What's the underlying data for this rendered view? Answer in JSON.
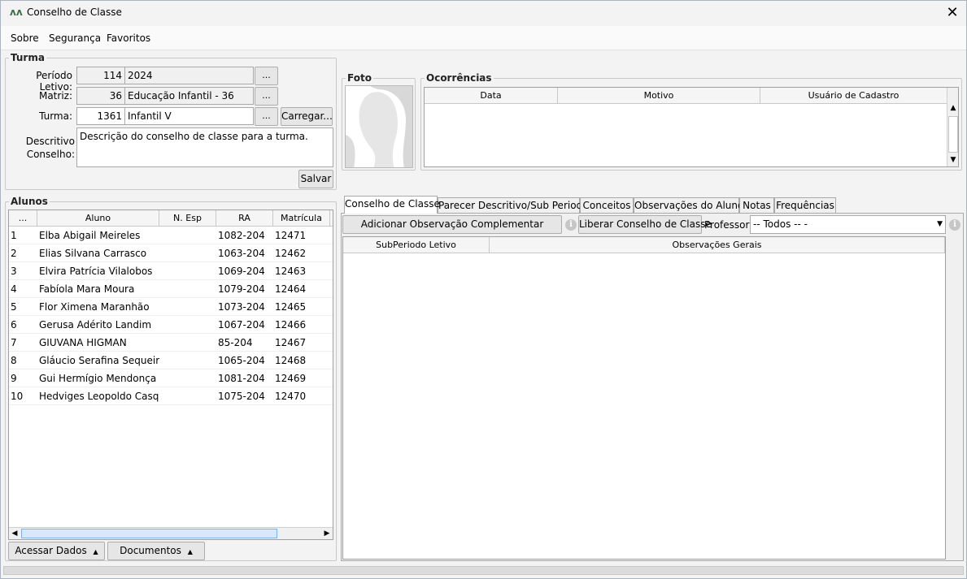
{
  "window": {
    "title": "Conselho de Classe",
    "logo": "ʌʌ",
    "close": "✕"
  },
  "menu": [
    {
      "label": "Sobre"
    },
    {
      "label": "Segurança"
    },
    {
      "label": "Favoritos"
    }
  ],
  "turma_group": {
    "legend": "Turma",
    "periodo_label": "Período Letivo:",
    "periodo_code": "114",
    "periodo_name": "2024",
    "matriz_label": "Matriz:",
    "matriz_code": "36",
    "matriz_name": "Educação Infantil - 36",
    "turma_label": "Turma:",
    "turma_code": "1361",
    "turma_name": "Infantil V",
    "dots": "...",
    "carregar": "Carregar...",
    "descritivo_label_1": "Descritivo",
    "descritivo_label_2": "Conselho:",
    "descritivo_value": "Descrição do conselho de classe para a turma.",
    "salvar": "Salvar"
  },
  "foto": {
    "legend": "Foto"
  },
  "ocorrencias": {
    "legend": "Ocorrências",
    "columns": [
      "Data",
      "Motivo",
      "Usuário de Cadastro"
    ]
  },
  "alunos": {
    "legend": "Alunos",
    "columns": [
      "...",
      "Aluno",
      "N. Esp",
      "RA",
      "Matrícula"
    ],
    "rows": [
      {
        "n": "1",
        "aluno": "Elba Abigail Meireles",
        "nesp": "",
        "ra": "1082-204",
        "matricula": "12471"
      },
      {
        "n": "2",
        "aluno": "Elias Silvana Carrasco",
        "nesp": "",
        "ra": "1063-204",
        "matricula": "12462"
      },
      {
        "n": "3",
        "aluno": "Elvira Patrícia Vilalobos",
        "nesp": "",
        "ra": "1069-204",
        "matricula": "12463"
      },
      {
        "n": "4",
        "aluno": "Fabíola Mara Moura",
        "nesp": "",
        "ra": "1079-204",
        "matricula": "12464"
      },
      {
        "n": "5",
        "aluno": "Flor Ximena Maranhão",
        "nesp": "",
        "ra": "1073-204",
        "matricula": "12465"
      },
      {
        "n": "6",
        "aluno": "Gerusa Adérito Landim",
        "nesp": "",
        "ra": "1067-204",
        "matricula": "12466"
      },
      {
        "n": "7",
        "aluno": "GIUVANA HIGMAN",
        "nesp": "",
        "ra": "85-204",
        "matricula": "12467"
      },
      {
        "n": "8",
        "aluno": "Gláucio Serafina Sequeira",
        "nesp": "",
        "ra": "1065-204",
        "matricula": "12468"
      },
      {
        "n": "9",
        "aluno": "Gui Hermígio Mendonça",
        "nesp": "",
        "ra": "1081-204",
        "matricula": "12469"
      },
      {
        "n": "10",
        "aluno": "Hedviges Leopoldo Casqu...",
        "nesp": "",
        "ra": "1075-204",
        "matricula": "12470"
      }
    ],
    "acessar_dados": "Acessar Dados",
    "documentos": "Documentos",
    "caret": "▲"
  },
  "tabs": [
    {
      "label": "Conselho de Classe",
      "active": true
    },
    {
      "label": "Parecer Descritivo/Sub Periodo"
    },
    {
      "label": "Conceitos"
    },
    {
      "label": "Observações do Aluno"
    },
    {
      "label": "Notas"
    },
    {
      "label": "Frequências"
    }
  ],
  "conselho_tab": {
    "adicionar": "Adicionar Observação Complementar",
    "liberar": "Liberar Conselho de Classe",
    "professor_label": "Professor:",
    "professor_value": "-- Todos -- -",
    "info": "i",
    "columns": [
      "SubPeriodo Letivo",
      "Observações Gerais"
    ]
  }
}
